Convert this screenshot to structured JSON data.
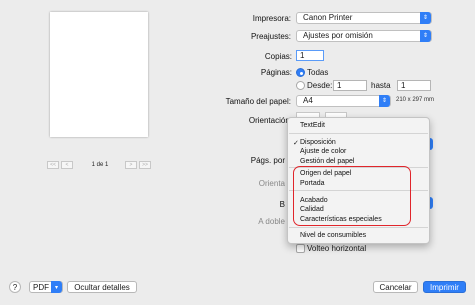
{
  "preview": {
    "page_indicator": "1 de 1",
    "first_label": "<<",
    "prev_label": "<",
    "next_label": ">",
    "last_label": ">>"
  },
  "printer": {
    "label": "Impresora:",
    "value": "Canon Printer"
  },
  "presets": {
    "label": "Preajustes:",
    "value": "Ajustes por omisión"
  },
  "copies": {
    "label": "Copias:",
    "value": "1"
  },
  "pages": {
    "label": "Páginas:",
    "all_label": "Todas",
    "from_label": "Desde:",
    "from_value": "1",
    "to_label": "hasta",
    "to_value": "1"
  },
  "paper_size": {
    "label": "Tamaño del papel:",
    "value": "A4",
    "dimensions": "210 x 297 mm"
  },
  "orientation": {
    "label": "Orientación:"
  },
  "partial_labels": {
    "pages_per": "Págs. por",
    "orient": "Orienta",
    "b": "B",
    "a_doble": "A doble",
    "flip": "Volteo horizontal"
  },
  "menu": {
    "header": "TextEdit",
    "items": [
      {
        "label": "Disposición",
        "checked": true
      },
      {
        "label": "Ajuste de color"
      },
      {
        "label": "Gestión del papel"
      },
      {
        "label": "Origen del papel"
      },
      {
        "label": "Portada"
      },
      {
        "label": "Acabado"
      },
      {
        "label": "Calidad"
      },
      {
        "label": "Características especiales"
      },
      {
        "label": "Nivel de consumibles"
      }
    ]
  },
  "footer": {
    "help": "?",
    "pdf": "PDF",
    "hide_details": "Ocultar detalles",
    "cancel": "Cancelar",
    "print": "Imprimir"
  },
  "colors": {
    "accent": "#2f7ef7",
    "highlight": "#e0252b"
  }
}
